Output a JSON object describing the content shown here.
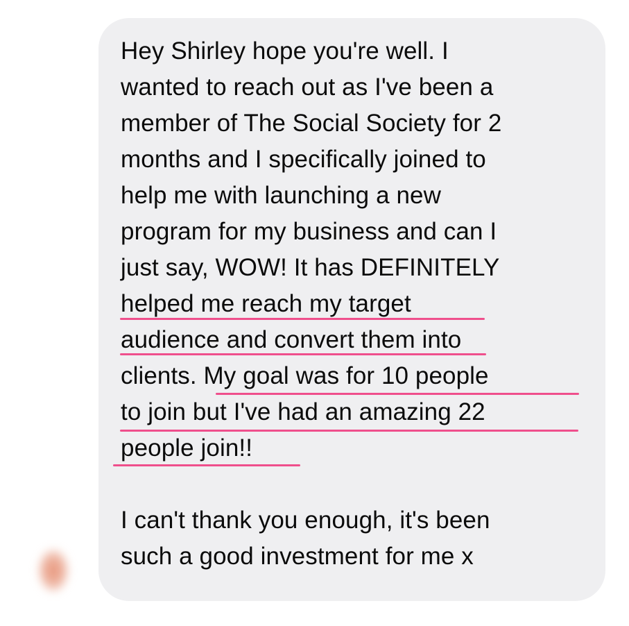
{
  "message": {
    "paragraph1": [
      "Hey Shirley hope you're well. I",
      "wanted to reach out as I've been a",
      "member of The Social Society for 2",
      "months and I specifically joined to",
      "help me with launching a new",
      "program for my business and can I",
      "just say, WOW! It has DEFINITELY",
      "helped me reach my target",
      "audience and convert them into",
      "clients. My goal was for 10 people",
      "to join but I've had an amazing 22",
      "people join!!"
    ],
    "paragraph2": [
      "I can't thank you enough, it's been",
      "such a good investment for me x"
    ]
  },
  "colors": {
    "bubble": "#efeff1",
    "text": "#0b0b0b",
    "highlight_underline": "#ef4f8c"
  }
}
